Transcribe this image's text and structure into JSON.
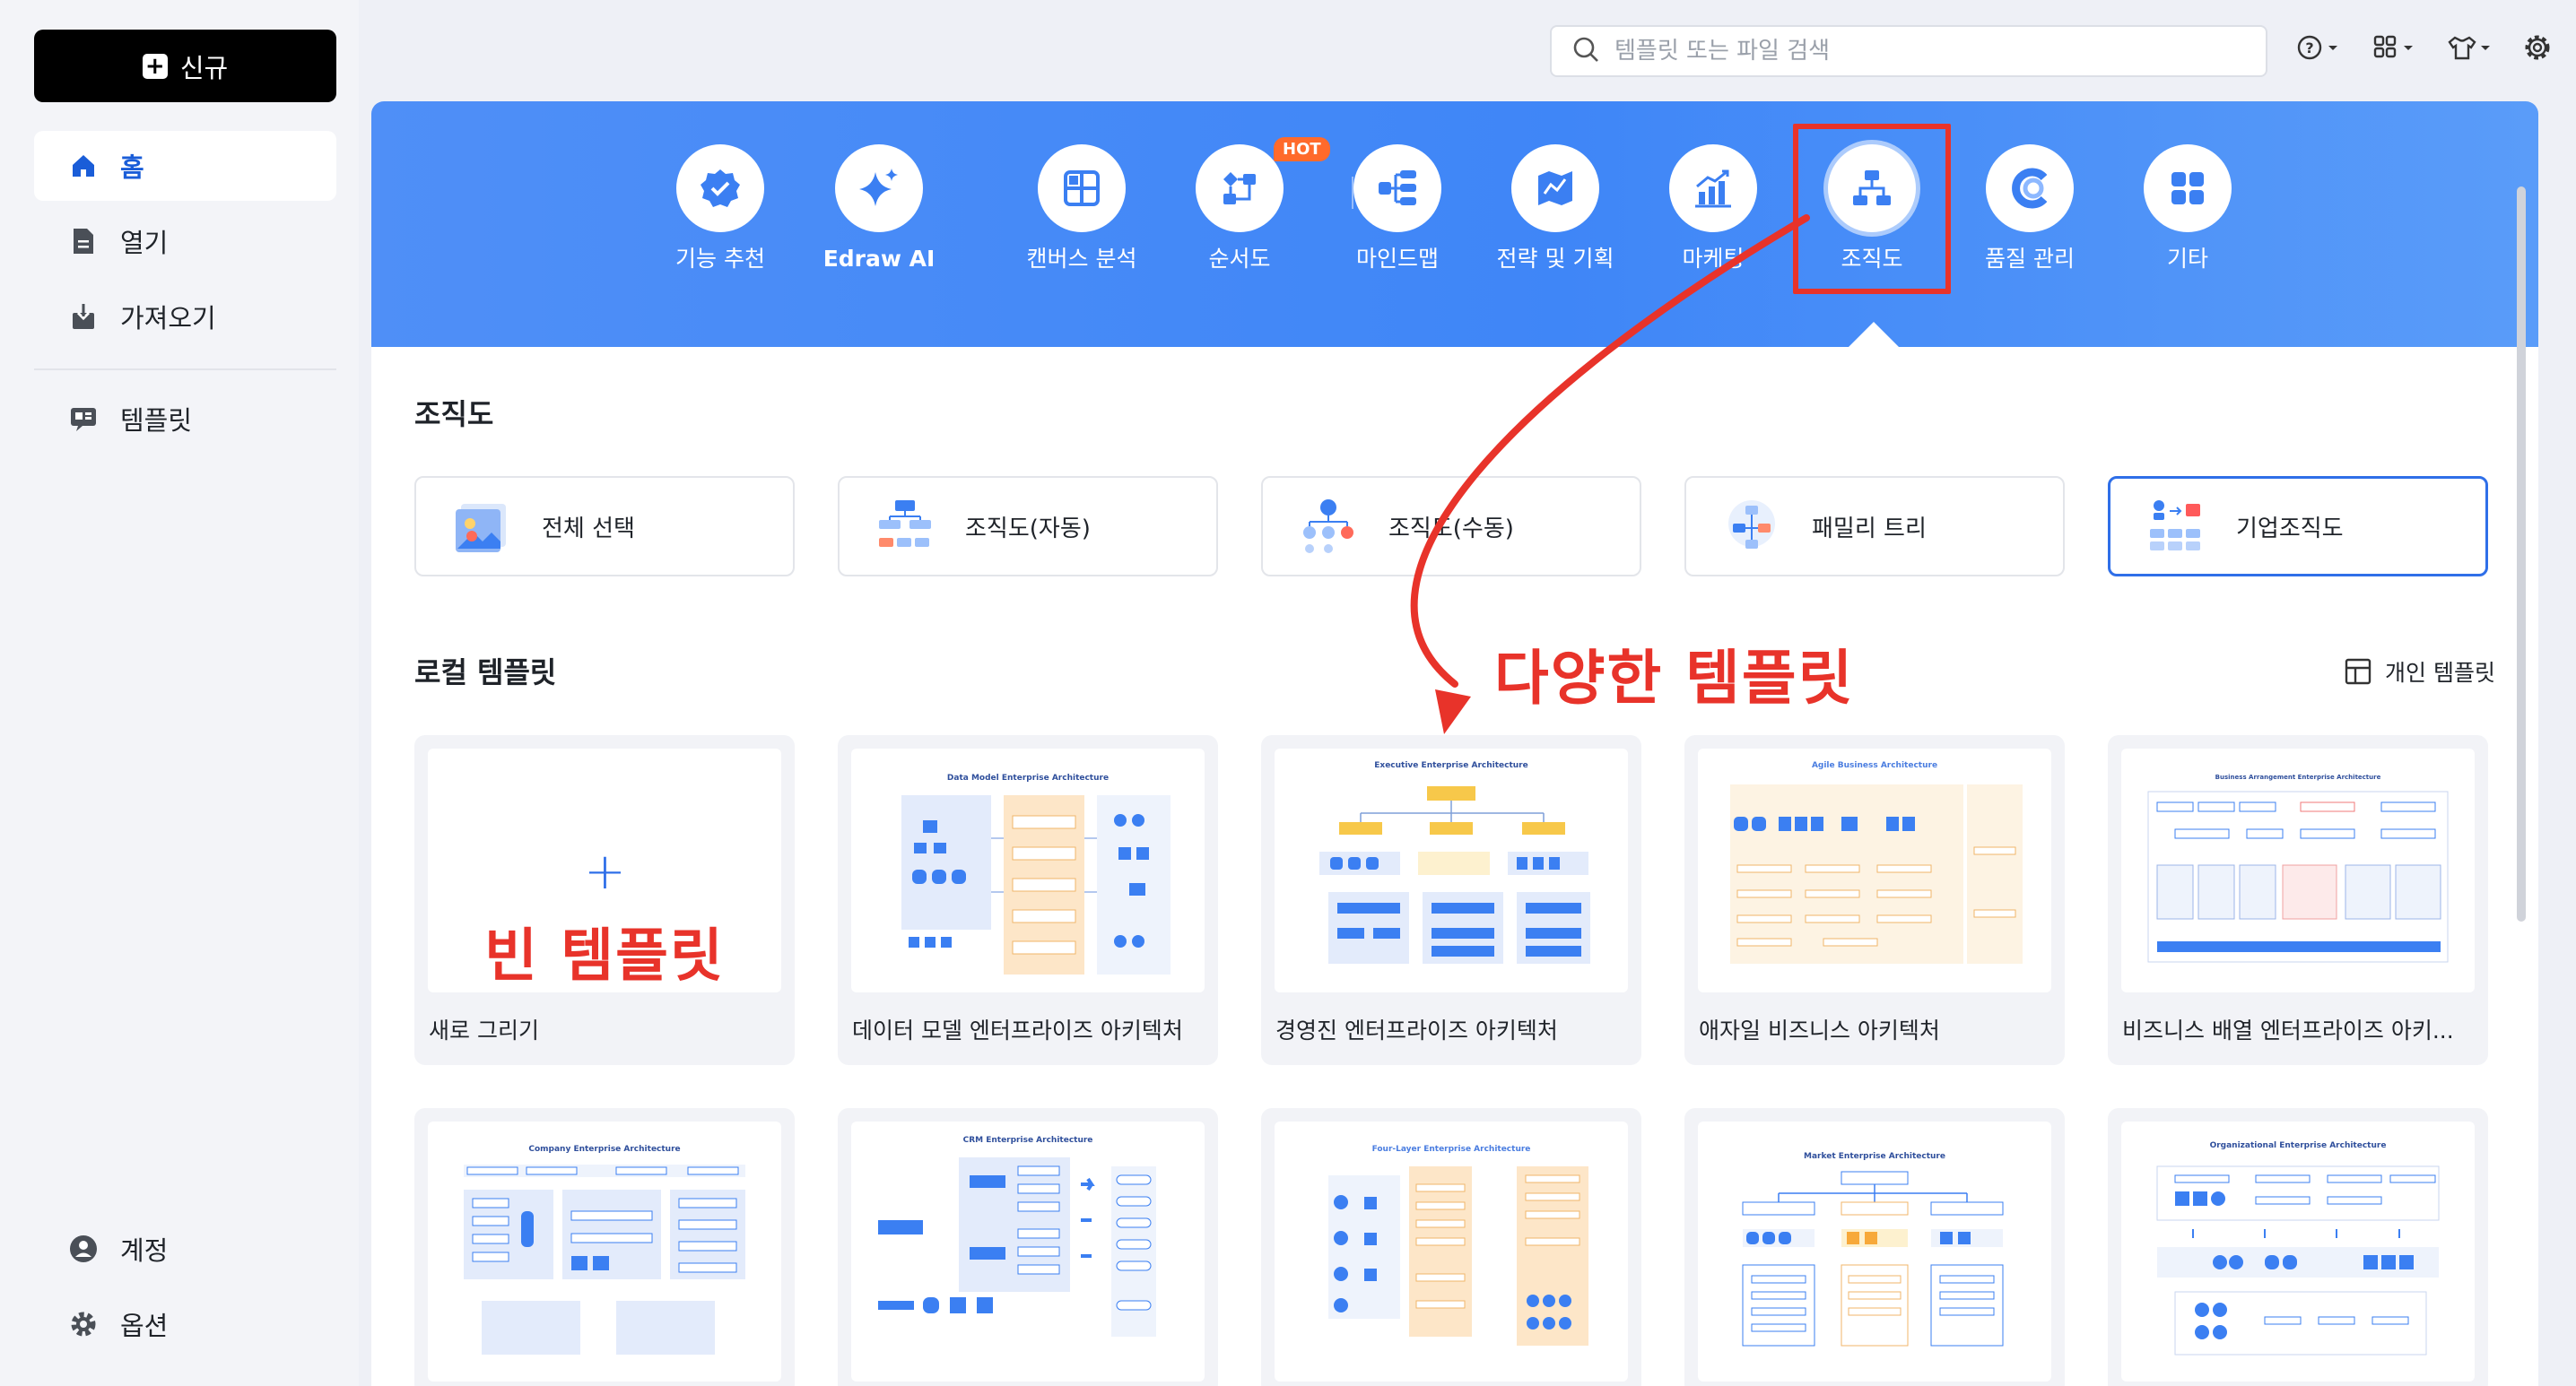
{
  "sidebar": {
    "new_button": "신규",
    "nav": [
      {
        "label": "홈",
        "icon": "home-icon"
      },
      {
        "label": "열기",
        "icon": "file-icon"
      },
      {
        "label": "가져오기",
        "icon": "import-icon"
      },
      {
        "label": "템플릿",
        "icon": "template-icon"
      }
    ],
    "bottom": [
      {
        "label": "계정",
        "icon": "account-icon"
      },
      {
        "label": "옵션",
        "icon": "gear-icon"
      }
    ]
  },
  "search": {
    "placeholder": "템플릿 또는 파일 검색"
  },
  "top_icons": [
    "help-icon",
    "apps-icon",
    "shirt-icon",
    "settings-icon"
  ],
  "banner": {
    "hot_badge": "HOT",
    "categories": [
      {
        "label": "기능 추천",
        "icon": "badge-check-icon"
      },
      {
        "label": "Edraw AI",
        "icon": "sparkle-icon"
      },
      {
        "label": "캔버스 분석",
        "icon": "grid-icon"
      },
      {
        "label": "순서도",
        "icon": "flowchart-icon"
      },
      {
        "label": "마인드맵",
        "icon": "mindmap-icon"
      },
      {
        "label": "전략 및 기획",
        "icon": "map-icon"
      },
      {
        "label": "마케팅",
        "icon": "chart-icon"
      },
      {
        "label": "조직도",
        "icon": "org-chart-icon"
      },
      {
        "label": "품질 관리",
        "icon": "quality-icon"
      },
      {
        "label": "기타",
        "icon": "more-icon"
      }
    ]
  },
  "org_section": {
    "title": "조직도",
    "subcategories": [
      "전체 선택",
      "조직도(자동)",
      "조직도(수동)",
      "패밀리 트리",
      "기업조직도"
    ]
  },
  "local_section": {
    "title": "로컬 템플릿",
    "private_link": "개인 템플릿",
    "templates": [
      {
        "name": "새로 그리기",
        "thumb_title": ""
      },
      {
        "name": "데이터 모델 엔터프라이즈 아키텍처",
        "thumb_title": "Data Model Enterprise Architecture"
      },
      {
        "name": "경영진 엔터프라이즈 아키텍처",
        "thumb_title": "Executive Enterprise Architecture"
      },
      {
        "name": "애자일 비즈니스 아키텍처",
        "thumb_title": "Agile Business Architecture"
      },
      {
        "name": "비즈니스 배열 엔터프라이즈 아키...",
        "thumb_title": "Business Arrangement Enterprise Architecture"
      }
    ],
    "templates_row2": [
      {
        "thumb_title": "Company Enterprise Architecture"
      },
      {
        "thumb_title": "CRM Enterprise Architecture"
      },
      {
        "thumb_title": "Four-Layer Enterprise Architecture"
      },
      {
        "thumb_title": "Market Enterprise Architecture"
      },
      {
        "thumb_title": "Organizational Enterprise Architecture"
      }
    ]
  },
  "annotations": {
    "blank_template": "빈 템플릿",
    "various_templates": "다양한 템플릿"
  },
  "colors": {
    "accent": "#2f6fe8",
    "banner": "#4a8cf7",
    "annotation": "#e8332a",
    "hot": "#ff6a2b"
  }
}
